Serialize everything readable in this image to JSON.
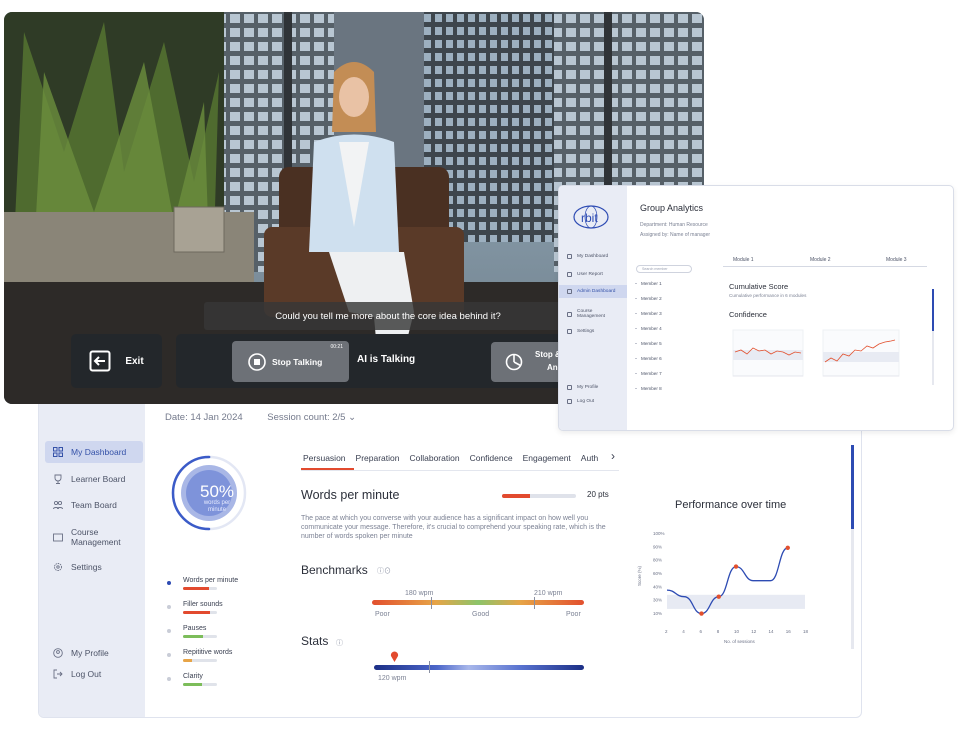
{
  "video": {
    "question": "Could you tell me more about the core idea behind it?",
    "exit_label": "Exit",
    "stop_talking_label": "Stop Talking",
    "timer": "00:21",
    "ai_status": "AI is Talking",
    "stop_analyse_line1": "Stop &",
    "stop_analyse_line2": "An"
  },
  "group_analytics": {
    "title": "Group Analytics",
    "department": "Department: Human Resource",
    "assigned_by": "Assigned by: Name of manager",
    "search_placeholder": "Search member",
    "sidebar": [
      "My Dashboard",
      "User Report",
      "Admin Dashboard",
      "Course Management",
      "Settings"
    ],
    "sidebar_bottom": [
      "My Profile",
      "Log Out"
    ],
    "members": [
      "Member 1",
      "Member 2",
      "Member 3",
      "Member 4",
      "Member 5",
      "Member 6",
      "Member 7",
      "Member 8"
    ],
    "modules": [
      "Module 1",
      "Module 2",
      "Module 3"
    ],
    "cumulative_title": "Cumulative Score",
    "cumulative_sub": "Cumulative performance in 6 modules",
    "confidence_title": "Confidence"
  },
  "dashboard": {
    "date": "Date: 14 Jan 2024",
    "session_count": "Session count: 2/5",
    "sidebar": [
      {
        "label": "My Dashboard",
        "icon": "grid-icon"
      },
      {
        "label": "Learner Board",
        "icon": "trophy-icon"
      },
      {
        "label": "Team Board",
        "icon": "team-icon"
      },
      {
        "label": "Course Management",
        "icon": "folder-icon"
      },
      {
        "label": "Settings",
        "icon": "gear-icon"
      }
    ],
    "sidebar_bottom": [
      {
        "label": "My Profile",
        "icon": "profile-icon"
      },
      {
        "label": "Log Out",
        "icon": "logout-icon"
      }
    ],
    "ring_value": "50%",
    "ring_sub": "words per minute",
    "ring_progress": 0.5,
    "metrics": [
      {
        "label": "Words per minute",
        "level": 0.75,
        "color": "#e24a2e"
      },
      {
        "label": "Filler sounds",
        "level": 0.8,
        "color": "#e24a2e"
      },
      {
        "label": "Pauses",
        "level": 0.6,
        "color": "#7cbd5a"
      },
      {
        "label": "Repititive words",
        "level": 0.25,
        "color": "#e7a447"
      },
      {
        "label": "Clarity",
        "level": 0.55,
        "color": "#7cbd5a"
      }
    ],
    "tabs": [
      "Persuasion",
      "Preparation",
      "Collaboration",
      "Confidence",
      "Engagement",
      "Auth"
    ],
    "wpm_title": "Words per minute",
    "wpm_points": "20 pts",
    "wpm_level": 0.38,
    "wpm_desc": "The pace at which you converse with your audience has a significant impact on how well you communicate your message. Therefore, it's crucial to comprehend your speaking rate, which is the number of words spoken per minute",
    "benchmarks_title": "Benchmarks",
    "bench_low": "180 wpm",
    "bench_high": "210 wpm",
    "bench_poor_left": "Poor",
    "bench_good": "Good",
    "bench_poor_right": "Poor",
    "stats_title": "Stats",
    "stats_value": "120 wpm",
    "perf_title": "Performance over time"
  },
  "chart_data": {
    "type": "line",
    "title": "Performance over time",
    "xlabel": "No. of sessions",
    "ylabel": "Score (%)",
    "x_ticks": [
      2,
      4,
      6,
      8,
      10,
      12,
      14,
      16,
      18
    ],
    "y_ticks": [
      "100%",
      "90%",
      "80%",
      "60%",
      "40%",
      "30%",
      "10%"
    ],
    "x": [
      2,
      4,
      6,
      8,
      10,
      12,
      14,
      16
    ],
    "y": [
      35,
      28,
      10,
      28,
      60,
      45,
      45,
      80
    ],
    "highlighted_points": [
      6,
      8,
      10,
      16
    ]
  },
  "colors": {
    "accent": "#2d4bb3",
    "alert": "#e24a2e",
    "sidebar_bg": "#e9ecf5"
  }
}
